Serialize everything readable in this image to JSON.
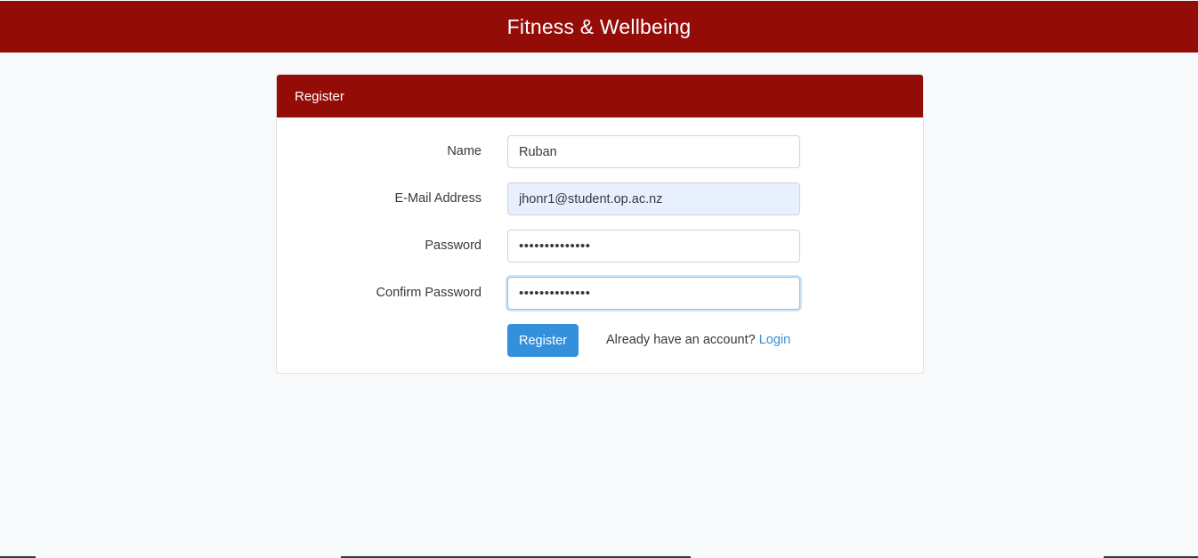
{
  "header": {
    "title": "Fitness & Wellbeing",
    "background_color": "#940c08"
  },
  "register_card": {
    "title": "Register",
    "fields": {
      "name": {
        "label": "Name",
        "value": "Ruban"
      },
      "email": {
        "label": "E-Mail Address",
        "value": "jhonr1@student.op.ac.nz"
      },
      "password": {
        "label": "Password",
        "value": "••••••••••••••"
      },
      "confirm_password": {
        "label": "Confirm Password",
        "value": "••••••••••••••"
      }
    },
    "submit_label": "Register",
    "login_prompt": "Already have an account?",
    "login_link": "Login"
  },
  "colors": {
    "accent": "#3490dc",
    "page_background": "#f8f9fb"
  }
}
